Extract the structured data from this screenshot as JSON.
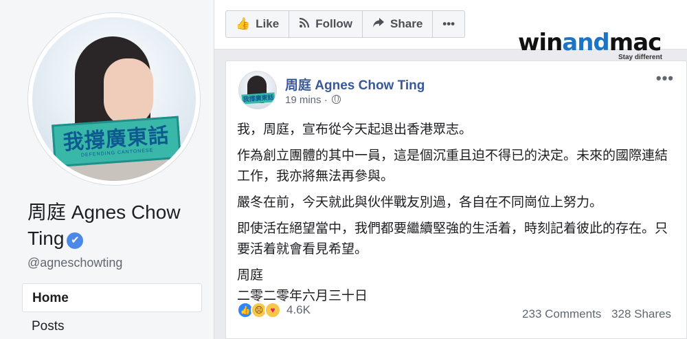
{
  "profile": {
    "name": "周庭 Agnes Chow Ting",
    "handle": "@agneschowting",
    "avatar_banner_text": "我撐廣東話",
    "avatar_banner_sub": "DEFENDING CANTONESE",
    "verified_glyph": "✔"
  },
  "nav": {
    "items": [
      {
        "label": "Home"
      },
      {
        "label": "Posts"
      }
    ]
  },
  "toolbar": {
    "like_label": "Like",
    "follow_label": "Follow",
    "share_label": "Share",
    "more_label": "•••"
  },
  "watermark": {
    "brand_start": "win",
    "brand_accent": "and",
    "brand_end": "mac",
    "tagline": "Stay different",
    "accent_color": "#1b74c5"
  },
  "post": {
    "author": "周庭 Agnes Chow Ting",
    "time": "19 mins",
    "privacy_icon": "globe-icon",
    "menu_label": "•••",
    "paragraphs": [
      "我，周庭，宣布從今天起退出香港眾志。",
      "作為創立團體的其中一員，這是個沉重且迫不得已的決定。未來的國際連結工作，我亦將無法再參與。",
      "嚴冬在前，今天就此與伙伴戰友別過，各自在不同崗位上努力。",
      "即使活在絕望當中，我們都要繼續堅強的生活着，時刻記着彼此的存在。只要活着就會看見希望。"
    ],
    "signature_name": "周庭",
    "signature_date": "二零二零年六月三十日",
    "reaction_count": "4.6K",
    "comments": "233 Comments",
    "shares": "328 Shares"
  },
  "colors": {
    "link_blue": "#385898",
    "page_bg": "#e9ebee",
    "verified_blue": "#4b88e8"
  }
}
